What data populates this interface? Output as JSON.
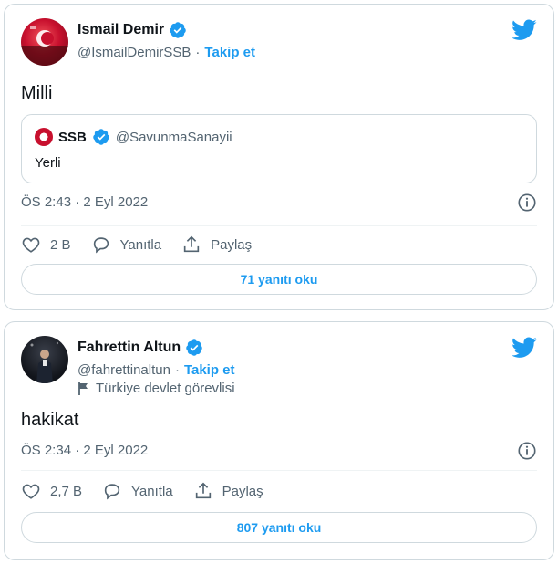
{
  "tweets": [
    {
      "author": {
        "name": "Ismail Demir",
        "handle": "@IsmailDemirSSB",
        "follow_label": "Takip et",
        "separator": "·"
      },
      "text": "Milli",
      "quote": {
        "name": "SSB",
        "handle": "@SavunmaSanayii",
        "text": "Yerli"
      },
      "timestamp": "ÖS 2:43 · 2 Eyl 2022",
      "actions": {
        "likes": "2 B",
        "reply_label": "Yanıtla",
        "share_label": "Paylaş"
      },
      "read_replies_label": "71 yanıtı oku"
    },
    {
      "author": {
        "name": "Fahrettin Altun",
        "handle": "@fahrettinaltun",
        "follow_label": "Takip et",
        "separator": "·",
        "label": "Türkiye devlet görevlisi"
      },
      "text": "hakikat",
      "timestamp": "ÖS 2:34 · 2 Eyl 2022",
      "actions": {
        "likes": "2,7 B",
        "reply_label": "Yanıtla",
        "share_label": "Paylaş"
      },
      "read_replies_label": "807 yanıtı oku"
    }
  ],
  "colors": {
    "accent": "#1d9bf0",
    "text": "#0f1419",
    "secondary": "#536471",
    "border": "#cfd9de"
  }
}
